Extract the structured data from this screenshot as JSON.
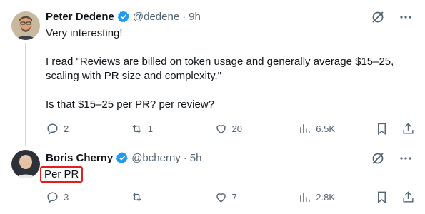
{
  "tweets": [
    {
      "author_name": "Peter Dedene",
      "handle": "@dedene",
      "time": "9h",
      "lines": [
        "Very interesting!",
        "",
        "I read \"Reviews are billed on token usage and generally average $15–25,",
        "scaling with PR size and complexity.\"",
        "",
        "Is that $15–25 per PR? per review?"
      ],
      "replies": "2",
      "reposts": "1",
      "likes": "20",
      "views": "6.5K"
    },
    {
      "author_name": "Boris Cherny",
      "handle": "@bcherny",
      "time": "5h",
      "text": "Per PR",
      "replies": "3",
      "reposts": "",
      "likes": "7",
      "views": "2.8K"
    }
  ],
  "separator": "·",
  "colors": {
    "verified": "#1d9bf0",
    "muted": "#536471",
    "thread_line": "#cfd9de",
    "highlight_border": "#e0201b"
  },
  "icons": [
    "verified-badge-icon",
    "grok-icon",
    "more-icon",
    "reply-icon",
    "repost-icon",
    "like-icon",
    "views-icon",
    "bookmark-icon",
    "share-icon"
  ]
}
